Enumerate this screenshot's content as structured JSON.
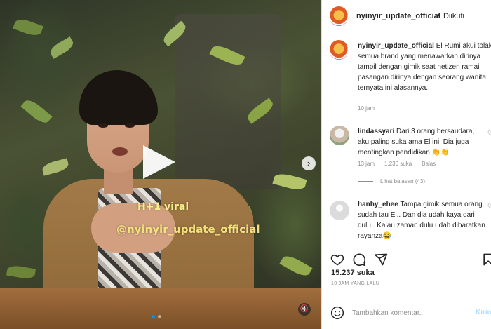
{
  "video": {
    "overlay_line1": "H+1 viral",
    "overlay_line2": "@nyinyir_update_official"
  },
  "header": {
    "username": "nyinyir_update_official",
    "separator": "•",
    "follow_label": "Diikuti"
  },
  "caption": {
    "username": "nyinyir_update_official",
    "text": "El Rumi akui tolak semua brand yang menawarkan dirinya tampil dengan gimik saat netizen ramai pasangan dirinya dengan seorang wanita, ternyata ini alasannya..",
    "time": "10 jam"
  },
  "comments": [
    {
      "username": "lindassyari",
      "text": "Dari 3 orang bersaudara, aku paling suka ama El ini. Dia juga mentingkan pendidikan 👏👏",
      "time": "13 jam",
      "likes": "1.230 suka",
      "reply": "Balas",
      "view_replies": "Lihat balasan (43)"
    },
    {
      "username": "hanhy_ehee",
      "text": "Tampa gimik semua orang sudah tau El.. Dan dia udah kaya dari dulu.. Kalau zaman dulu udah dibaratkan rayanza😂"
    }
  ],
  "post": {
    "likes": "15.237 suka",
    "timestamp": "10 JAM YANG LALU"
  },
  "comment_box": {
    "placeholder": "Tambahkan komentar...",
    "post_label": "Kirim"
  },
  "colors": {
    "accent": "#0095f6",
    "text": "#262626",
    "muted": "#8e8e8e",
    "post_disabled": "#b2dffc"
  },
  "icons": [
    "play-icon",
    "next-arrow-icon",
    "mute-icon",
    "heart-icon",
    "comment-icon",
    "share-icon",
    "bookmark-icon",
    "emoji-icon"
  ]
}
